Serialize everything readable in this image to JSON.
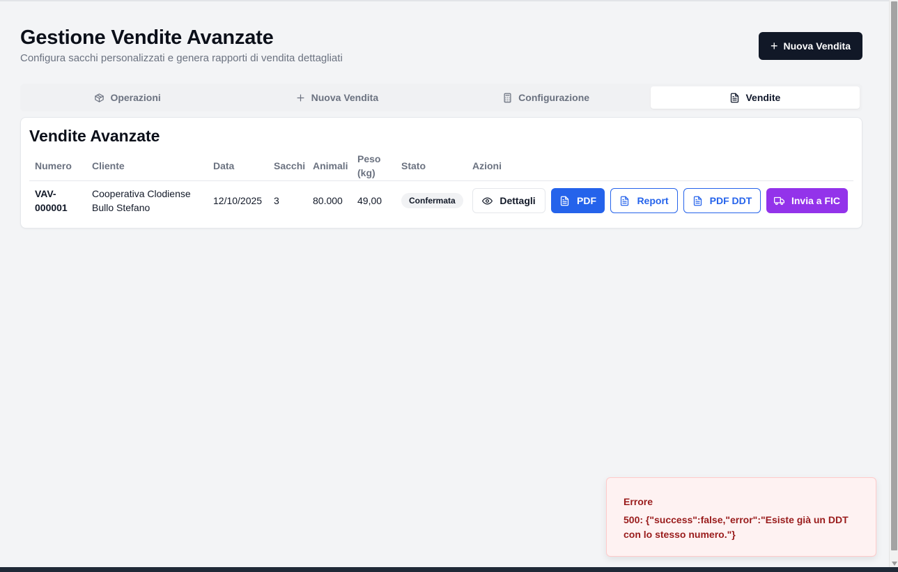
{
  "header": {
    "title": "Gestione Vendite Avanzate",
    "subtitle": "Configura sacchi personalizzati e genera rapporti di vendita dettagliati",
    "new_sale_button": "Nuova Vendita"
  },
  "tabs": [
    {
      "label": "Operazioni",
      "icon": "package-icon",
      "active": false
    },
    {
      "label": "Nuova Vendita",
      "icon": "plus-icon",
      "active": false
    },
    {
      "label": "Configurazione",
      "icon": "calculator-icon",
      "active": false
    },
    {
      "label": "Vendite",
      "icon": "file-text-icon",
      "active": true
    }
  ],
  "sales": {
    "title": "Vendite Avanzate",
    "columns": {
      "numero": "Numero",
      "cliente": "Cliente",
      "data": "Data",
      "sacchi": "Sacchi",
      "animali": "Animali",
      "peso_line1": "Peso",
      "peso_line2": "(kg)",
      "stato": "Stato",
      "azioni": "Azioni"
    },
    "rows": [
      {
        "numero_line1": "VAV-",
        "numero_line2": "000001",
        "cliente_line1": "Cooperativa Clodiense",
        "cliente_line2": "Bullo Stefano",
        "data": "12/10/2025",
        "sacchi": "3",
        "animali": "80.000",
        "peso": "49,00",
        "stato": "Confermata"
      }
    ],
    "actions": {
      "details": "Dettagli",
      "pdf": "PDF",
      "report": "Report",
      "pdf_ddt": "PDF DDT",
      "send_fic": "Invia a FIC"
    }
  },
  "toast": {
    "title": "Errore",
    "message": "500: {\"success\":false,\"error\":\"Esiste già un DDT con lo stesso numero.\"}"
  },
  "colors": {
    "primary_dark": "#111827",
    "blue": "#2563eb",
    "purple": "#9333ea",
    "error_text": "#991b1b",
    "error_bg": "#fef2f2"
  }
}
